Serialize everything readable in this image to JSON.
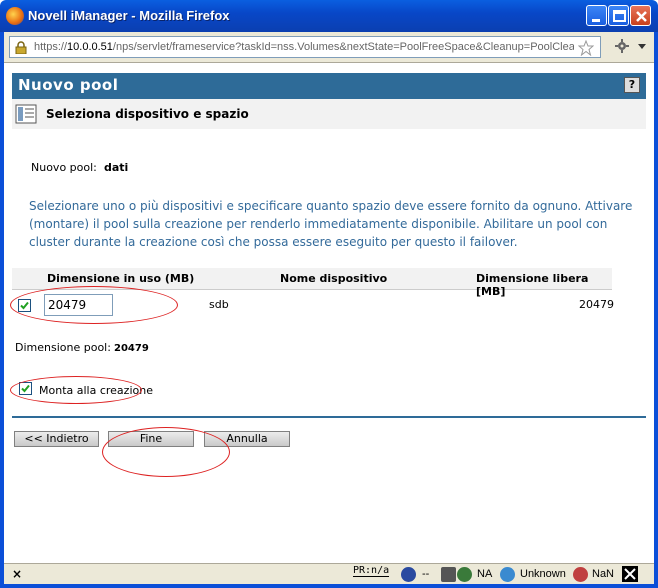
{
  "window": {
    "title": "Novell iManager - Mozilla Firefox"
  },
  "address_bar": {
    "url_prefix": "https://",
    "url_host": "10.0.0.51",
    "url_path": "/nps/servlet/frameservice?taskId=nss.Volumes&nextState=PoolFreeSpace&Cleanup=PoolClea"
  },
  "header": {
    "title": "Nuovo pool",
    "help_label": "?"
  },
  "subheader": {
    "title": "Seleziona dispositivo e spazio"
  },
  "pool": {
    "label": "Nuovo pool:",
    "name": "dati"
  },
  "description": "Selezionare uno o più dispositivi e specificare quanto spazio deve essere fornito da ognuno. Attivare (montare) il pool sulla creazione per renderlo immediatamente disponibile. Abilitare un pool con cluster durante la creazione così che possa essere eseguito per questo il failover.",
  "table": {
    "columns": [
      "Dimensione in uso (MB)",
      "Nome dispositivo",
      "Dimensione libera [MB]"
    ],
    "rows": [
      {
        "checked": true,
        "size_in_use": "20479",
        "device": "sdb",
        "free_size": "20479"
      }
    ]
  },
  "pool_size": {
    "label": "Dimensione pool:",
    "value": "20479"
  },
  "mount": {
    "checked": true,
    "label": "Monta alla creazione"
  },
  "buttons": {
    "back": "<< Indietro",
    "finish": "Fine",
    "cancel": "Annulla"
  },
  "statusbar": {
    "close": "×",
    "pr": "PR:n/a",
    "dash": "--",
    "na": "NA",
    "unknown": "Unknown",
    "nan": "NaN"
  },
  "colors": {
    "header_blue": "#2e6b98",
    "description_text": "#336a9a",
    "annotation_red": "#dd2222"
  }
}
